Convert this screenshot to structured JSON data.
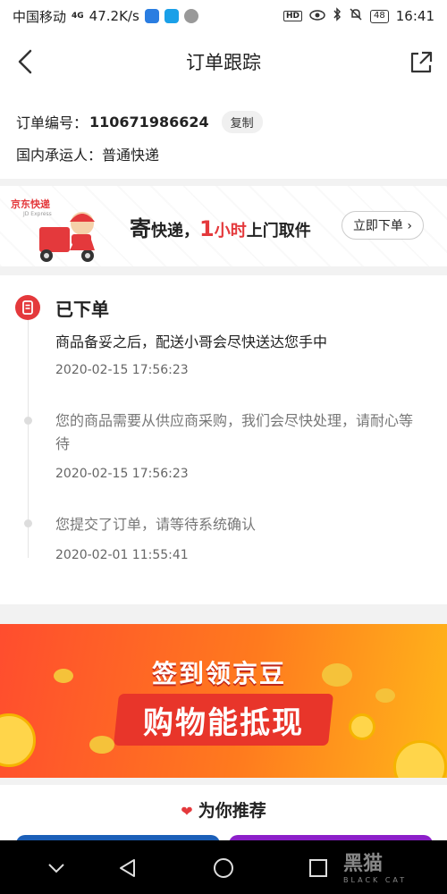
{
  "status_bar": {
    "carrier": "中国移动",
    "network": "4G",
    "speed": "47.2K/s",
    "battery": "48",
    "time": "16:41"
  },
  "header": {
    "title": "订单跟踪"
  },
  "order": {
    "number_label": "订单编号：",
    "number": "110671986624",
    "copy_label": "复制",
    "carrier_label": "国内承运人：",
    "carrier_value": "普通快递"
  },
  "express_banner": {
    "logo": "京东快递",
    "logo_en": "JD Express",
    "slogan_1": "寄",
    "slogan_2": "快递，",
    "slogan_3": "1",
    "slogan_4": "小时",
    "slogan_5": "上门取件",
    "button": "立即下单"
  },
  "tracking": {
    "status": "已下单",
    "events": [
      {
        "message": "商品备妥之后，配送小哥会尽快送达您手中",
        "time": "2020-02-15 17:56:23"
      },
      {
        "message": "您的商品需要从供应商采购，我们会尽快处理，请耐心等待",
        "time": "2020-02-15 17:56:23"
      },
      {
        "message": "您提交了订单，请等待系统确认",
        "time": "2020-02-01 11:55:41"
      }
    ]
  },
  "promo": {
    "title": "签到领京豆",
    "subtitle": "购物能抵现"
  },
  "recommend": {
    "title": "为你推荐"
  },
  "watermark": {
    "text": "黑猫",
    "sub": "BLACK CAT"
  }
}
